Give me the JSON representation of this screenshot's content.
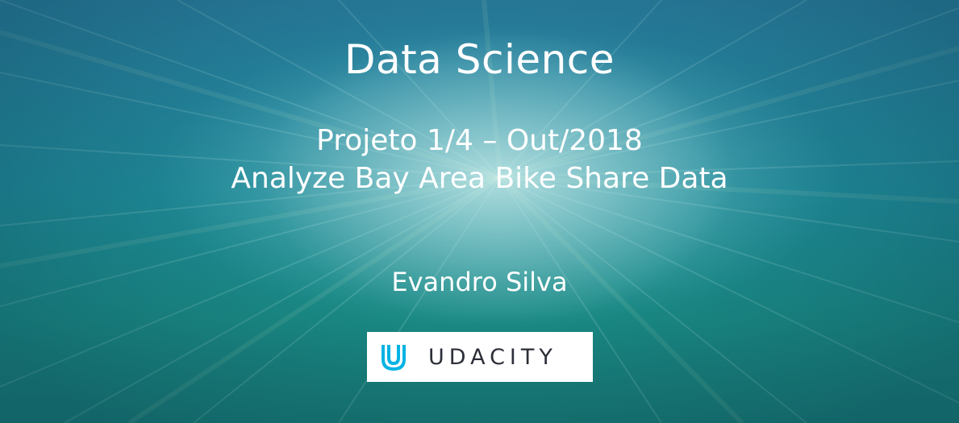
{
  "slide": {
    "title": "Data Science",
    "subtitle_line1": "Projeto 1/4 – Out/2018",
    "subtitle_line2": "Analyze Bay Area Bike Share Data",
    "author": "Evandro Silva",
    "logo": {
      "icon": "udacity-logo-icon",
      "text": "UDACITY",
      "accent": "#02b3e4"
    },
    "background_colors": {
      "top": "#2a7fa0",
      "middle": "#1f8a98",
      "bottom": "#177a74"
    }
  }
}
